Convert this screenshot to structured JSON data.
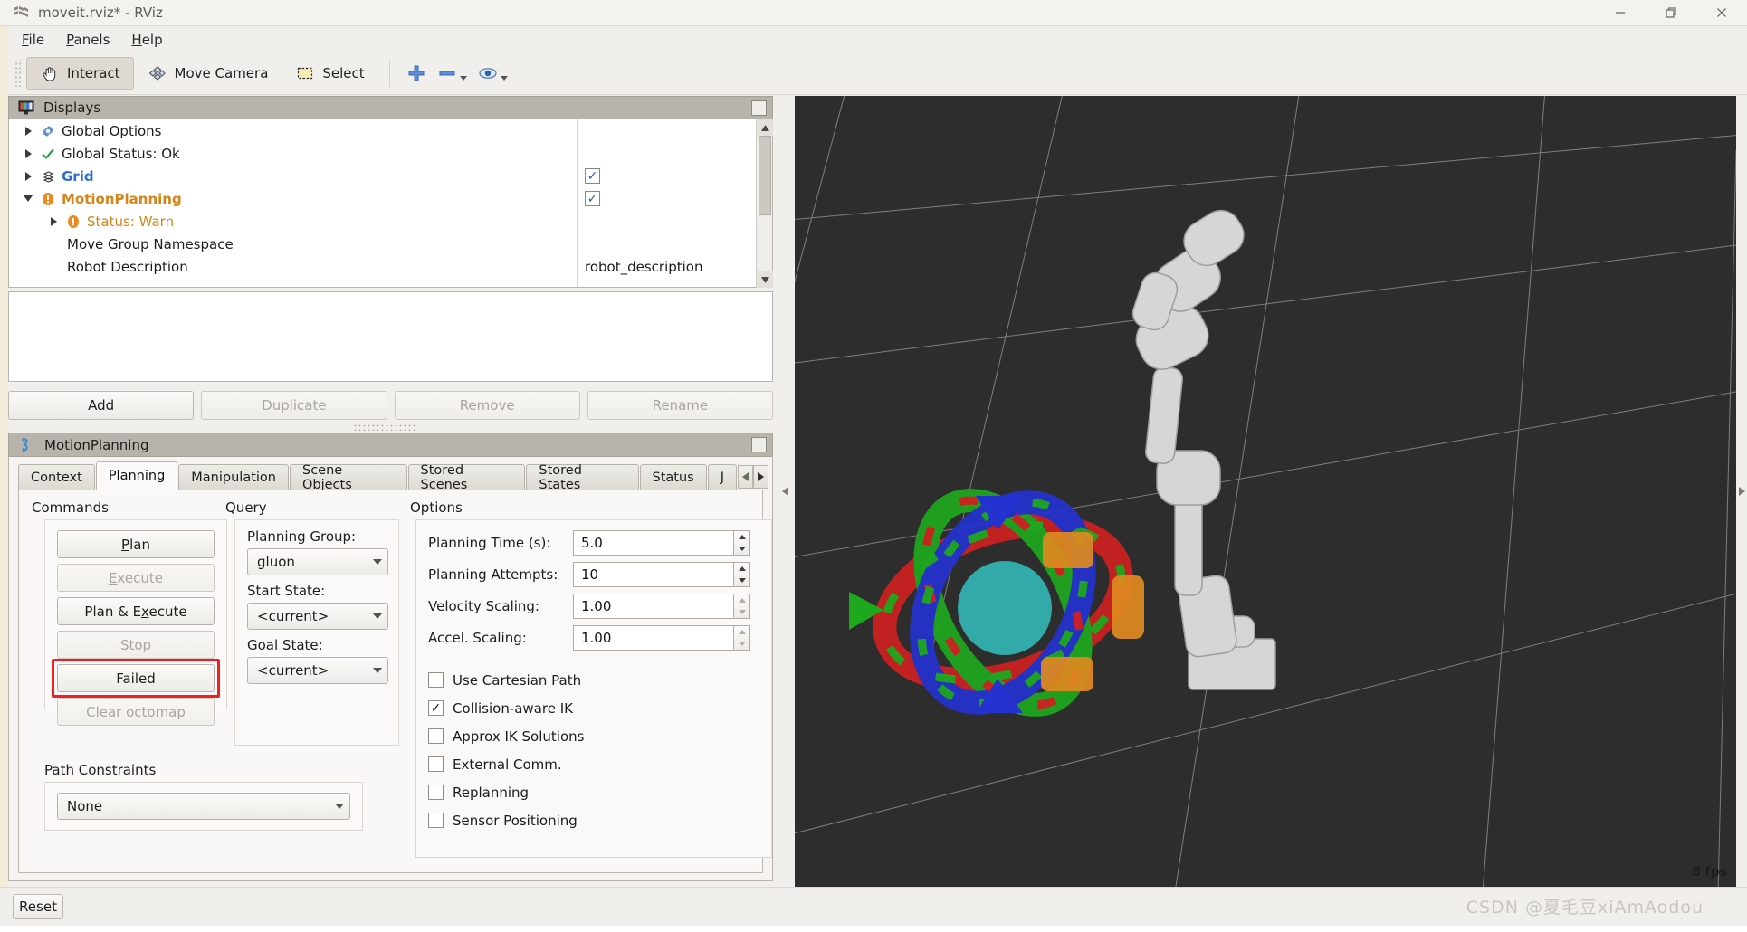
{
  "window": {
    "title": "moveit.rviz* - RViz",
    "app_icon": "rviz-icon",
    "controls": {
      "minimize": "minimize-icon",
      "maximize": "maximize-icon",
      "close": "close-icon"
    }
  },
  "menubar": {
    "items": [
      {
        "label": "File",
        "mnemonic": "F"
      },
      {
        "label": "Panels",
        "mnemonic": "P"
      },
      {
        "label": "Help",
        "mnemonic": "H"
      }
    ]
  },
  "toolbar": {
    "items": [
      {
        "label": "Interact",
        "icon": "hand-cursor-icon",
        "active": true
      },
      {
        "label": "Move Camera",
        "icon": "move-camera-icon",
        "active": false
      },
      {
        "label": "Select",
        "icon": "select-rect-icon",
        "active": false
      }
    ],
    "tools": [
      {
        "icon": "plus-icon",
        "label": ""
      },
      {
        "icon": "minus-icon",
        "label": ""
      },
      {
        "icon": "focus-camera-icon",
        "label": ""
      }
    ]
  },
  "displays_panel": {
    "title": "Displays",
    "icon": "displays-monitor-icon",
    "rows": [
      {
        "label": "Global Options",
        "icon": "gear-icon",
        "twisty": "right",
        "indent": 0,
        "style": "normal",
        "value": ""
      },
      {
        "label": "Global Status: Ok",
        "icon": "check-icon",
        "twisty": "right",
        "indent": 0,
        "style": "normal",
        "value": ""
      },
      {
        "label": "Grid",
        "icon": "grid-icon",
        "twisty": "right",
        "indent": 0,
        "style": "link",
        "value": "",
        "checked": true
      },
      {
        "label": "MotionPlanning",
        "icon": "warning-icon",
        "twisty": "down",
        "indent": 0,
        "style": "warn",
        "value": "",
        "checked": true
      },
      {
        "label": "Status: Warn",
        "icon": "warning-icon",
        "twisty": "right",
        "indent": 1,
        "style": "warnsub",
        "value": ""
      },
      {
        "label": "Move Group Namespace",
        "icon": "",
        "twisty": "",
        "indent": 2,
        "style": "normal",
        "value": ""
      },
      {
        "label": "Robot Description",
        "icon": "",
        "twisty": "",
        "indent": 2,
        "style": "normal",
        "value": "robot_description"
      }
    ]
  },
  "display_buttons": [
    {
      "label": "Add",
      "enabled": true
    },
    {
      "label": "Duplicate",
      "enabled": false
    },
    {
      "label": "Remove",
      "enabled": false
    },
    {
      "label": "Rename",
      "enabled": false
    }
  ],
  "motion_planning": {
    "title": "MotionPlanning",
    "icon": "motionplanning-icon",
    "tabs": [
      {
        "label": "Context",
        "active": false
      },
      {
        "label": "Planning",
        "active": true
      },
      {
        "label": "Manipulation",
        "active": false
      },
      {
        "label": "Scene Objects",
        "active": false
      },
      {
        "label": "Stored Scenes",
        "active": false
      },
      {
        "label": "Stored States",
        "active": false
      },
      {
        "label": "Status",
        "active": false
      },
      {
        "label": "J",
        "active": false
      }
    ],
    "tab_scroll": {
      "left": "chevron-left-icon",
      "right": "chevron-right-icon"
    },
    "commands": {
      "title": "Commands",
      "buttons": [
        {
          "label": "Plan",
          "mnemonic": "P",
          "enabled": true,
          "highlight": false
        },
        {
          "label": "Execute",
          "mnemonic": "E",
          "enabled": false,
          "highlight": false
        },
        {
          "label": "Plan & Execute",
          "mnemonic": "x",
          "enabled": true,
          "highlight": false
        },
        {
          "label": "Stop",
          "mnemonic": "S",
          "enabled": false,
          "highlight": false
        },
        {
          "label": "Failed",
          "mnemonic": "",
          "enabled": true,
          "highlight": true
        },
        {
          "label": "Clear octomap",
          "mnemonic": "",
          "enabled": false,
          "highlight": false
        }
      ]
    },
    "query": {
      "title": "Query",
      "fields": [
        {
          "label": "Planning Group:",
          "value": "gluon"
        },
        {
          "label": "Start State:",
          "value": "<current>"
        },
        {
          "label": "Goal State:",
          "value": "<current>"
        }
      ]
    },
    "options": {
      "title": "Options",
      "spinners": [
        {
          "label": "Planning Time (s):",
          "value": "5.0"
        },
        {
          "label": "Planning Attempts:",
          "value": "10"
        },
        {
          "label": "Velocity Scaling:",
          "value": "1.00"
        },
        {
          "label": "Accel. Scaling:",
          "value": "1.00"
        }
      ],
      "checkboxes": [
        {
          "label": "Use Cartesian Path",
          "checked": false
        },
        {
          "label": "Collision-aware IK",
          "checked": true
        },
        {
          "label": "Approx IK Solutions",
          "checked": false
        },
        {
          "label": "External Comm.",
          "checked": false
        },
        {
          "label": "Replanning",
          "checked": false
        },
        {
          "label": "Sensor Positioning",
          "checked": false
        }
      ]
    },
    "path_constraints": {
      "title": "Path Constraints",
      "value": "None"
    }
  },
  "view3d": {
    "fps": "8 fps",
    "background_color": "#2d2d2d",
    "grid_color": "#9a9a9a",
    "robot_color": "#d6d6d6",
    "marker_colors": {
      "x_axis": "#e02020",
      "y_axis": "#20b020",
      "z_axis": "#2030e0",
      "eef": "#e08a20",
      "sphere": "#34c6c6"
    }
  },
  "statusbar": {
    "reset_label": "Reset",
    "watermark": "CSDN @夏毛豆xiAmAodou"
  }
}
